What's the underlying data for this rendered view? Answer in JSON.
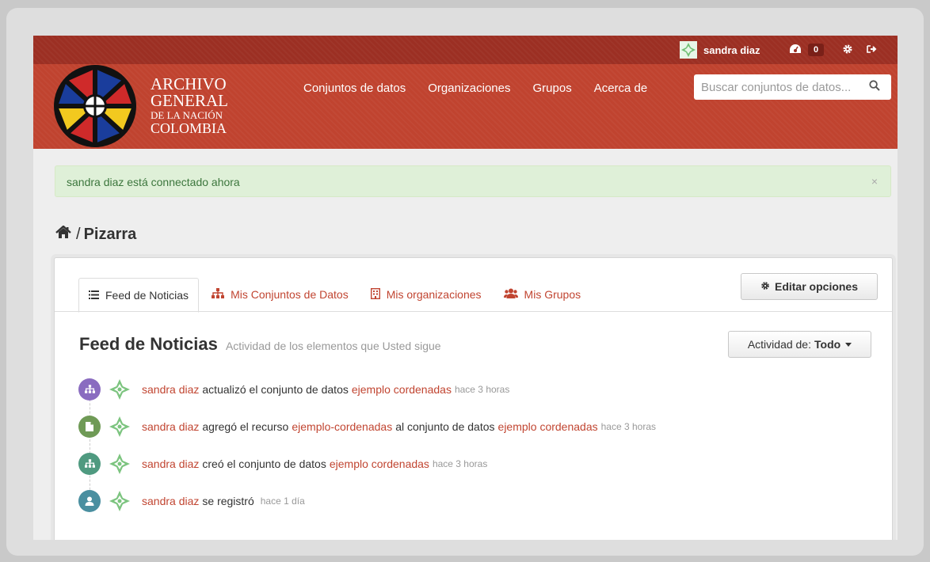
{
  "account": {
    "username": "sandra diaz",
    "dashboard_count": "0"
  },
  "brand": {
    "line1": "ARCHIVO",
    "line2": "GENERAL",
    "line3": "DE LA NACIÓN",
    "line4": "COLOMBIA"
  },
  "nav": {
    "items": [
      "Conjuntos de datos",
      "Organizaciones",
      "Grupos",
      "Acerca de"
    ]
  },
  "search": {
    "placeholder": "Buscar conjuntos de datos..."
  },
  "flash": {
    "message": "sandra diaz está connectado ahora",
    "close": "×"
  },
  "breadcrumb": {
    "sep": "/",
    "current": "Pizarra"
  },
  "tabs": [
    "Feed de Noticias",
    "Mis Conjuntos de Datos",
    "Mis organizaciones",
    "Mis Grupos"
  ],
  "edit_button": "Editar opciones",
  "feed": {
    "title": "Feed de Noticias",
    "subtitle": "Actividad de los elementos que Usted sigue",
    "filter_label": "Actividad de:",
    "filter_value": "Todo"
  },
  "activities": [
    {
      "user": "sandra diaz",
      "t1": "actualizó el conjunto de datos",
      "link1": "ejemplo cordenadas",
      "t2": "",
      "link2": "",
      "time": "hace 3 horas",
      "color": "#8a6cc0"
    },
    {
      "user": "sandra diaz",
      "t1": "agregó el recurso",
      "link1": "ejemplo-cordenadas",
      "t2": "al conjunto de datos",
      "link2": "ejemplo cordenadas",
      "time": "hace 3 horas",
      "color": "#6f9a56"
    },
    {
      "user": "sandra diaz",
      "t1": "creó el conjunto de datos",
      "link1": "ejemplo cordenadas",
      "t2": "",
      "link2": "",
      "time": "hace 3 horas",
      "color": "#4f9a80"
    },
    {
      "user": "sandra diaz",
      "t1": "se registró",
      "link1": "",
      "t2": "",
      "link2": "",
      "time": "hace 1 día",
      "color": "#4a8fa0"
    }
  ]
}
